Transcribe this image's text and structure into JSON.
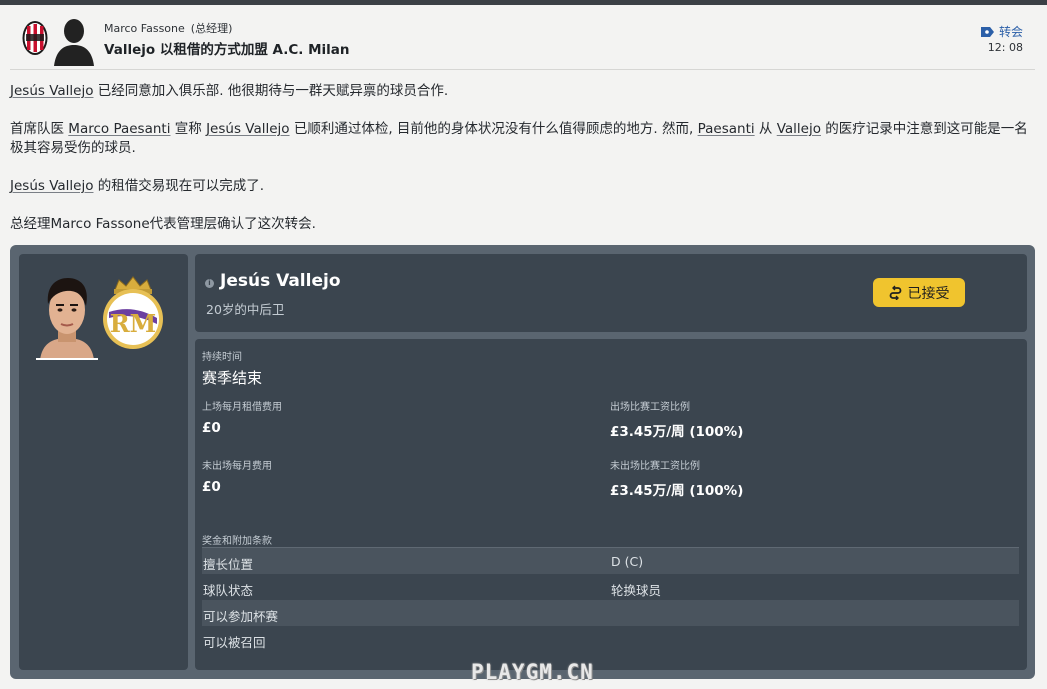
{
  "header": {
    "sender_name": "Marco Fassone",
    "sender_role": "(总经理)",
    "subject": "Vallejo 以租借的方式加盟 A.C. Milan",
    "tag_label": "转会",
    "time": "12: 08"
  },
  "message": {
    "p1": {
      "player": "Jesús Vallejo",
      "text": " 已经同意加入俱乐部. 他很期待与一群天赋异禀的球员合作."
    },
    "p2": {
      "t1": "首席队医 ",
      "doctor": "Marco Paesanti",
      "t2": " 宣称 ",
      "player": "Jesús Vallejo",
      "t3": " 已顺利通过体检, 目前他的身体状况没有什么值得顾虑的地方. 然而, ",
      "doctor_short": "Paesanti",
      "t4": " 从 ",
      "player_short": "Vallejo",
      "t5": " 的医疗记录中注意到这可能是一名极其容易受伤的球员."
    },
    "p3": {
      "player": "Jesús Vallejo",
      "text": " 的租借交易现在可以完成了."
    },
    "p4": "总经理Marco Fassone代表管理层确认了这次转会."
  },
  "player_card": {
    "name": "Jesús Vallejo",
    "description": "20岁的中后卫",
    "status_label": "已接受"
  },
  "loan": {
    "duration_label": "持续时间",
    "duration_value": "赛季结束",
    "monthly_fee_played_label": "上场每月租借费用",
    "monthly_fee_played_value": "£0",
    "wage_share_played_label": "出场比赛工资比例",
    "wage_share_played_value": "£3.45万/周 (100%)",
    "monthly_fee_unplayed_label": "未出场每月费用",
    "monthly_fee_unplayed_value": "£0",
    "wage_share_unplayed_label": "未出场比赛工资比例",
    "wage_share_unplayed_value": "£3.45万/周 (100%)"
  },
  "clauses": {
    "title": "奖金和附加条款",
    "rows": [
      {
        "key": "擅长位置",
        "value": "D (C)"
      },
      {
        "key": "球队状态",
        "value": "轮换球员"
      },
      {
        "key": "可以参加杯赛",
        "value": ""
      },
      {
        "key": "可以被召回",
        "value": ""
      }
    ]
  },
  "watermark": "PLAYGM.CN",
  "colors": {
    "panel": "#5a6570",
    "card": "#3b454f",
    "accepted_badge": "#f0c42e",
    "tag_blue": "#2b5fa8"
  },
  "icons": [
    "milan-crest-icon",
    "manager-silhouette-icon",
    "transfer-tag-icon",
    "info-icon",
    "accepted-icon",
    "real-madrid-crest-icon",
    "player-face"
  ]
}
